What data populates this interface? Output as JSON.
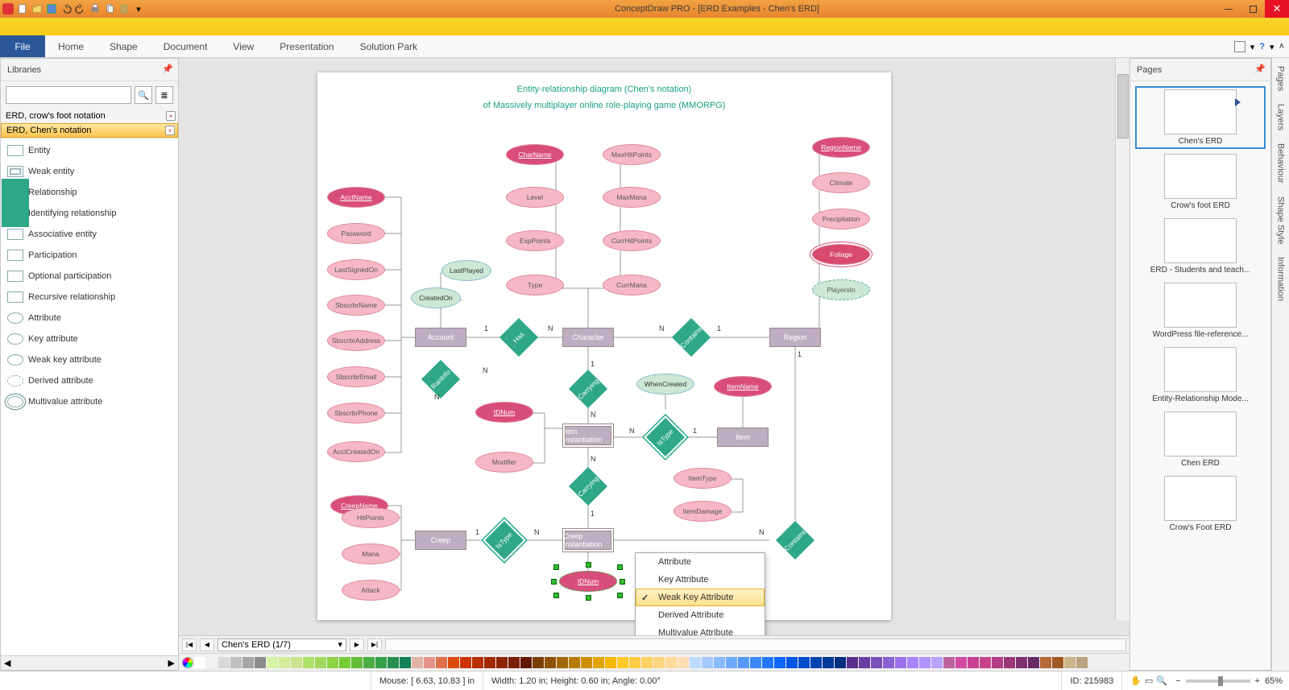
{
  "app": {
    "title": "ConceptDraw PRO - [ERD Examples - Chen's ERD]"
  },
  "ribbon": {
    "file": "File",
    "tabs": [
      "Home",
      "Shape",
      "Document",
      "View",
      "Presentation",
      "Solution Park"
    ]
  },
  "libraries": {
    "title": "Libraries",
    "search_placeholder": "",
    "files": [
      {
        "name": "ERD, crow's foot notation"
      },
      {
        "name": "ERD, Chen's notation"
      }
    ],
    "shapes": [
      "Entity",
      "Weak entity",
      "Relationship",
      "Identifying relationship",
      "Associative entity",
      "Participation",
      "Optional participation",
      "Recursive relationship",
      "Attribute",
      "Key attribute",
      "Weak key attribute",
      "Derived attribute",
      "Multivalue attribute"
    ]
  },
  "diagram": {
    "title_l1": "Entity-relationship diagram (Chen's notation)",
    "title_l2": "of Massively multiplayer online role-playing game (MMORPG)",
    "entities": {
      "account": "Account",
      "character": "Character",
      "region": "Region",
      "item_inst": "Item Instantiation",
      "item": "Item",
      "creep": "Creep",
      "creep_inst": "Creep Instantiation"
    },
    "rels": {
      "has": "Has",
      "contains": "Contains",
      "raninfo": "RanInfo",
      "carrying": "Carrying",
      "carrying2": "Carrying",
      "istype": "IsType",
      "istype2": "IsType",
      "contains2": "Contains"
    },
    "attrs": {
      "acctname": "AcctName",
      "password": "Password",
      "lastsignedon": "LastSignedOn",
      "sbscrbrname": "SbscrbrName",
      "sbscrbraddress": "SbscrbrAddress",
      "sbscrbremail": "SbscrbrEmail",
      "sbscrbrphone": "SbscrbrPhone",
      "acctcreatedon": "AcctCreatedOn",
      "createdon": "CreatedOn",
      "lastplayed": "LastPlayed",
      "charname": "CharName",
      "level": "Level",
      "exppoints": "ExpPoints",
      "type": "Type",
      "maxhitpoints": "MaxHitPoints",
      "maxmana": "MaxMana",
      "currhitpoints": "CurrHitPoints",
      "currmana": "CurrMana",
      "regionname": "RegionName",
      "climate": "Climate",
      "precipitation": "Precipitation",
      "foliage": "Foliage",
      "playersin": "PlayersIn",
      "whencreated": "WhenCreated",
      "itemname": "ItemName",
      "idnum": "IDNum",
      "modifier": "Modifier",
      "itemtype": "ItemType",
      "itemdamage": "ItemDamage",
      "creepname": "CreepName",
      "hitpoints": "HitPoints",
      "mana": "Mana",
      "attack": "Attack",
      "idnum2": "IDNum"
    },
    "cards": {
      "one": "1",
      "many": "N"
    }
  },
  "context_menu": {
    "items": [
      "Attribute",
      "Key Attribute",
      "Weak Key Attribute",
      "Derived Attribute",
      "Multivalue Attribute"
    ],
    "selected_index": 2
  },
  "sheet_tab": "Chen's ERD (1/7)",
  "pages": {
    "title": "Pages",
    "items": [
      "Chen's ERD",
      "Crow's foot ERD",
      "ERD - Students and teach...",
      "WordPress file-reference...",
      "Entity-Relationship Mode...",
      "Chen ERD",
      "Crow's Foot ERD"
    ]
  },
  "vtabs": [
    "Pages",
    "Layers",
    "Behaviour",
    "Shape Style",
    "Information"
  ],
  "colors": [
    "#ffffff",
    "#f2f2f2",
    "#d9d9d9",
    "#bfbfbf",
    "#a6a6a6",
    "#8c8c8c",
    "#d5f5a6",
    "#d4ec9b",
    "#cbe38f",
    "#aee06c",
    "#a0d959",
    "#8cd345",
    "#76cc33",
    "#61bd3a",
    "#4bae42",
    "#35a04a",
    "#249151",
    "#148259",
    "#e2b4a6",
    "#e7938c",
    "#e06f4c",
    "#da4a0d",
    "#cc3300",
    "#b82e00",
    "#a32900",
    "#8f2400",
    "#7a1f00",
    "#611900",
    "#7a3e00",
    "#8f5200",
    "#a36700",
    "#b87b00",
    "#cc9000",
    "#e1a400",
    "#f5b900",
    "#ffca29",
    "#ffce45",
    "#ffd261",
    "#ffd67d",
    "#ffda99",
    "#ffdeb5",
    "#bddbff",
    "#a3cbff",
    "#89baff",
    "#6faaff",
    "#5599ff",
    "#3b89ff",
    "#2178ff",
    "#0d68ff",
    "#0057e6",
    "#004dcc",
    "#0043b3",
    "#003999",
    "#002f80",
    "#5b2e8b",
    "#6a3fa3",
    "#7a50bb",
    "#8a61d3",
    "#9a72eb",
    "#aa83ff",
    "#b094ff",
    "#b7a5ff",
    "#bd64a0",
    "#d449a3",
    "#c74093",
    "#c8418b",
    "#b33d85",
    "#9a357a",
    "#81306f",
    "#682a65",
    "#b56836",
    "#9f5a23",
    "#ccb48a",
    "#baa480"
  ],
  "status": {
    "mouse": "Mouse: [ 6.63, 10.83 ] in",
    "dim": "Width: 1.20 in;  Height: 0.60 in;  Angle: 0.00°",
    "id": "ID: 215983",
    "zoom": "65%"
  }
}
